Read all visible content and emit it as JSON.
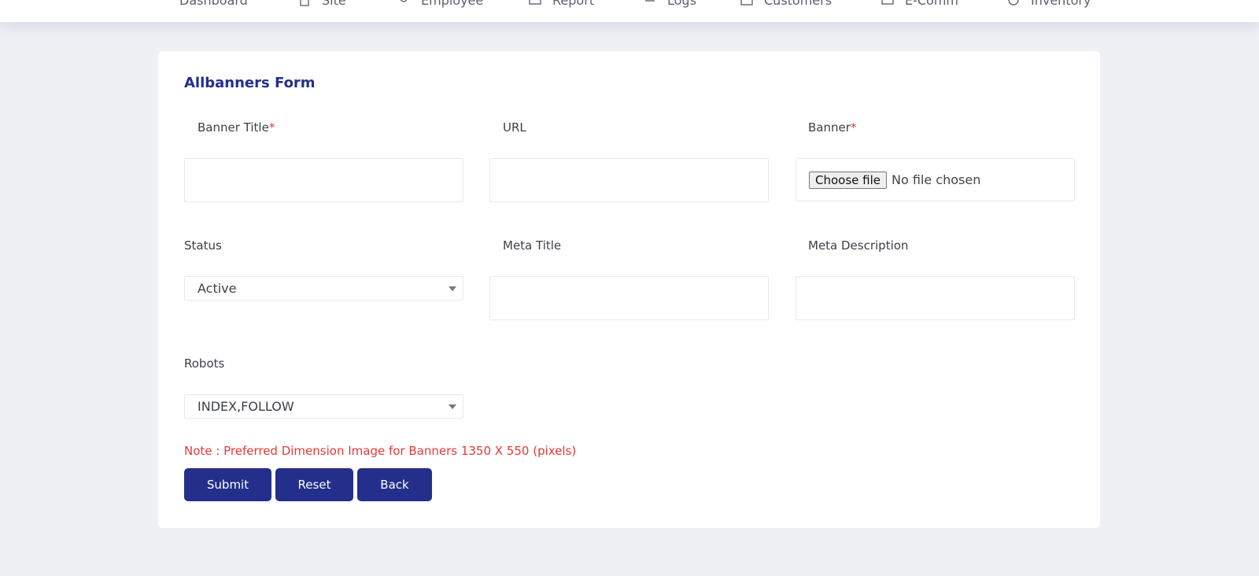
{
  "nav": {
    "items": [
      {
        "label": "Dashboard",
        "icon": "grid-icon"
      },
      {
        "label": "Site",
        "icon": "document-icon"
      },
      {
        "label": "Employee",
        "icon": "user-icon"
      },
      {
        "label": "Report",
        "icon": "chart-icon"
      },
      {
        "label": "Logs",
        "icon": "list-icon"
      },
      {
        "label": "Customers",
        "icon": "users-icon"
      },
      {
        "label": "E-Comm",
        "icon": "cart-icon"
      },
      {
        "label": "Inventory",
        "icon": "box-icon"
      }
    ]
  },
  "form": {
    "title": "Allbanners Form",
    "fields": {
      "banner_title": {
        "label": "Banner Title",
        "required_mark": "*",
        "value": ""
      },
      "url": {
        "label": "URL",
        "value": ""
      },
      "banner": {
        "label": "Banner",
        "required_mark": "*",
        "button_label": "Choose file",
        "file_status": "No file chosen"
      },
      "status": {
        "label": "Status",
        "selected": "Active"
      },
      "meta_title": {
        "label": "Meta Title",
        "value": ""
      },
      "meta_description": {
        "label": "Meta Description",
        "value": ""
      },
      "robots": {
        "label": "Robots",
        "selected": "INDEX,FOLLOW"
      }
    },
    "note": "Note : Preferred Dimension Image for Banners 1350 X 550 (pixels)",
    "buttons": {
      "submit": "Submit",
      "reset": "Reset",
      "back": "Back"
    }
  },
  "colors": {
    "brand": "#232f8b",
    "required": "#e53935",
    "background": "#eef0f4"
  }
}
